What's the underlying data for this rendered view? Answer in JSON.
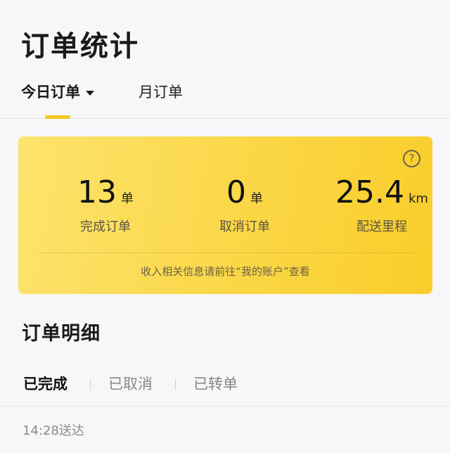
{
  "header": {
    "title": "订单统计"
  },
  "tabs": {
    "today": "今日订单",
    "month": "月订单"
  },
  "stats": {
    "completed": {
      "value": "13",
      "unit": "单",
      "caption": "完成订单"
    },
    "cancelled": {
      "value": "0",
      "unit": "单",
      "caption": "取消订单"
    },
    "distance": {
      "value": "25.4",
      "unit": "km",
      "caption": "配送里程"
    },
    "help_icon": "question-circle-icon",
    "note": "收入相关信息请前往“我的账户”查看"
  },
  "details": {
    "title": "订单明细",
    "filters": [
      "已完成",
      "已取消",
      "已转单"
    ]
  },
  "orders": [
    {
      "time_label": "14:28送达"
    }
  ],
  "colors": {
    "accent": "#f6c91e",
    "card_start": "#fde36e",
    "card_end": "#f9cd2a"
  }
}
